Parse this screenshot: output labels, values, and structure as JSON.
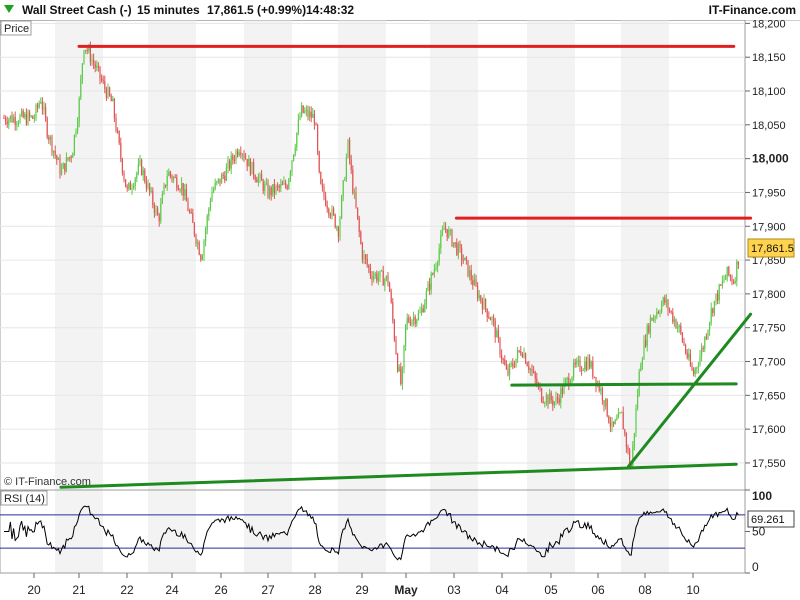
{
  "header": {
    "instrument": "Wall Street Cash (-)",
    "timeframe": "15 minutes",
    "last_change": "17,861.5 (+0.99%)",
    "time": "14:48:32",
    "brand": "IT-Finance.com",
    "direction_icon": "triangle-down-icon"
  },
  "price_panel": {
    "label": "Price",
    "watermark": "© IT-Finance.com",
    "last_price_badge": "17,861.5",
    "badge_color": "#ffd34d",
    "y_ticks": [
      "18,200",
      "18,150",
      "18,100",
      "18,050",
      "18,000",
      "17,950",
      "17,900",
      "17,850",
      "17,800",
      "17,750",
      "17,700",
      "17,650",
      "17,600",
      "17,550"
    ],
    "up_color": "#5cc94a",
    "down_color": "#e05555"
  },
  "rsi_panel": {
    "label": "RSI (14)",
    "value_badge": "69.261",
    "y_ticks": [
      "100",
      "50",
      "0"
    ],
    "levels": [
      70,
      30
    ]
  },
  "x_axis": {
    "labels": [
      "20",
      "21",
      "22",
      "24",
      "26",
      "27",
      "28",
      "29",
      "May",
      "03",
      "04",
      "05",
      "06",
      "08",
      "10"
    ]
  },
  "chart_data": {
    "type": "candlestick",
    "title": "Wall Street Cash (-)",
    "interval": "15 minutes",
    "x_sessions": [
      "20",
      "21",
      "22",
      "24",
      "26",
      "27",
      "28",
      "29",
      "May",
      "03",
      "04",
      "05",
      "06",
      "08",
      "10"
    ],
    "ylim": [
      17510,
      18205
    ],
    "last_close": 17861.5,
    "price_path": [
      [
        0,
        18060
      ],
      [
        0.15,
        18090
      ],
      [
        0.3,
        18040
      ],
      [
        0.6,
        17980
      ],
      [
        0.85,
        18010
      ],
      [
        1.0,
        18080
      ],
      [
        1.1,
        18170
      ],
      [
        1.25,
        18150
      ],
      [
        1.5,
        18110
      ],
      [
        1.7,
        18080
      ],
      [
        1.85,
        18010
      ],
      [
        2.0,
        17950
      ],
      [
        2.3,
        17990
      ],
      [
        2.7,
        17910
      ],
      [
        2.9,
        17980
      ],
      [
        3.2,
        17960
      ],
      [
        3.6,
        17855
      ],
      [
        3.8,
        17950
      ],
      [
        4.1,
        17980
      ],
      [
        4.4,
        18020
      ],
      [
        4.6,
        17990
      ],
      [
        5.0,
        17950
      ],
      [
        5.4,
        17960
      ],
      [
        5.7,
        18070
      ],
      [
        6.0,
        18060
      ],
      [
        6.1,
        17960
      ],
      [
        6.5,
        17895
      ],
      [
        6.7,
        18020
      ],
      [
        6.8,
        17960
      ],
      [
        7.0,
        17860
      ],
      [
        7.2,
        17830
      ],
      [
        7.6,
        17820
      ],
      [
        7.8,
        17700
      ],
      [
        7.9,
        17660
      ],
      [
        8.0,
        17760
      ],
      [
        8.3,
        17770
      ],
      [
        8.6,
        17840
      ],
      [
        8.8,
        17900
      ],
      [
        9.2,
        17850
      ],
      [
        9.5,
        17800
      ],
      [
        9.8,
        17760
      ],
      [
        10.1,
        17680
      ],
      [
        10.4,
        17720
      ],
      [
        10.8,
        17650
      ],
      [
        11.1,
        17640
      ],
      [
        11.5,
        17690
      ],
      [
        11.8,
        17700
      ],
      [
        12.1,
        17650
      ],
      [
        12.3,
        17600
      ],
      [
        12.5,
        17620
      ],
      [
        12.7,
        17540
      ],
      [
        12.9,
        17700
      ],
      [
        13.1,
        17760
      ],
      [
        13.4,
        17790
      ],
      [
        13.7,
        17750
      ],
      [
        14.0,
        17680
      ],
      [
        14.2,
        17720
      ],
      [
        14.4,
        17780
      ],
      [
        14.7,
        17830
      ],
      [
        14.85,
        17820
      ],
      [
        14.97,
        17861.5
      ]
    ],
    "trendlines": [
      {
        "name": "resistance-1",
        "color": "#e02020",
        "points": [
          [
            1.0,
            18166
          ],
          [
            14.85,
            18166
          ]
        ]
      },
      {
        "name": "resistance-2",
        "color": "#e02020",
        "points": [
          [
            9.05,
            17912
          ],
          [
            15.2,
            17912
          ]
        ]
      },
      {
        "name": "support-horizontal",
        "color": "#1f8a1f",
        "points": [
          [
            10.2,
            17665
          ],
          [
            14.9,
            17667
          ]
        ]
      },
      {
        "name": "support-rising-long",
        "color": "#1f8a1f",
        "points": [
          [
            0.6,
            17514
          ],
          [
            14.9,
            17548
          ]
        ]
      },
      {
        "name": "support-rising-steep",
        "color": "#1f8a1f",
        "points": [
          [
            12.65,
            17545
          ],
          [
            15.2,
            17770
          ]
        ]
      }
    ],
    "rsi": {
      "name": "RSI (14)",
      "ylim": [
        0,
        100
      ],
      "levels": [
        70,
        30
      ],
      "last": 69.261
    }
  }
}
